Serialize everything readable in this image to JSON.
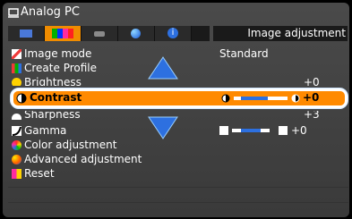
{
  "header": {
    "title": "Analog PC"
  },
  "tabs": {
    "items": [
      {
        "name": "picture-tab",
        "color": "#4a78d8",
        "selected": false
      },
      {
        "name": "color-tab",
        "color": "#f08c00",
        "selected": true
      },
      {
        "name": "input-tab",
        "color": "#7a7a7a",
        "selected": false
      },
      {
        "name": "blue-ball-tab",
        "color": "#2d70e0",
        "selected": false
      },
      {
        "name": "info-tab",
        "color": "#2d70e0",
        "selected": false
      }
    ],
    "panel_title": "Image adjustment"
  },
  "menu": {
    "image_mode_label": "Image mode",
    "image_mode_value": "Standard",
    "create_profile_label": "Create Profile",
    "brightness_label": "Brightness",
    "brightness_value": "+0",
    "contrast_label": "Contrast",
    "contrast_value": "+0",
    "sharpness_label": "Sharpness",
    "sharpness_value": "+3",
    "gamma_label": "Gamma",
    "gamma_value": "+0",
    "color_adjust_label": "Color adjustment",
    "advanced_adjust_label": "Advanced adjustment",
    "reset_label": "Reset"
  },
  "colors": {
    "selection": "#ff8a00",
    "arrow": "#2d70e0",
    "slider_fill": "#2d70e0"
  }
}
